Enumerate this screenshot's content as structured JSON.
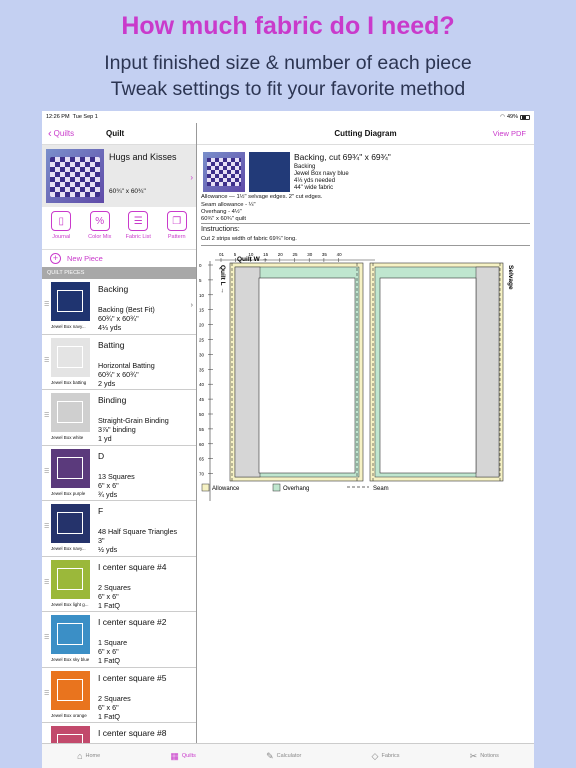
{
  "hero": {
    "title": "How much fabric do I need?",
    "line1": "Input finished size & number of each piece",
    "line2": "Tweak settings to fit your favorite method"
  },
  "status": {
    "time": "12:26 PM",
    "date": "Tue Sep 1",
    "battery": "49%"
  },
  "left_nav": {
    "back": "Quilts",
    "title": "Quilt"
  },
  "quilt": {
    "name": "Hugs and Kisses",
    "size": "60¾\" x 60¾\""
  },
  "tools": [
    {
      "label": "Journal",
      "icon": "journal-icon"
    },
    {
      "label": "Color Mix",
      "icon": "percent-icon"
    },
    {
      "label": "Fabric List",
      "icon": "list-icon"
    },
    {
      "label": "Pattern",
      "icon": "pattern-icon"
    }
  ],
  "new_piece": "New Piece",
  "section_title": "QUILT PIECES",
  "pieces": [
    {
      "title": "Backing",
      "d1": "Backing (Best Fit)",
      "d2": "60¾\" x 60¾\"",
      "d3": "4⅓ yds",
      "fabric": "Jewel Box navy...",
      "color": "#1f3470"
    },
    {
      "title": "Batting",
      "d1": "Horizontal Batting",
      "d2": "60¾\" x 60¾\"",
      "d3": "2 yds",
      "fabric": "Jewel Box batting",
      "color": "#e4e4e4"
    },
    {
      "title": "Binding",
      "d1": "Straight-Grain Binding",
      "d2": "3⅞\" binding",
      "d3": "1 yd",
      "fabric": "Jewel Box white",
      "color": "#cfcfcf"
    },
    {
      "title": "D",
      "d1": "13 Squares",
      "d2": "6\" x 6\"",
      "d3": "¾ yds",
      "fabric": "Jewel Box purple",
      "color": "#5b3a7c"
    },
    {
      "title": "F",
      "d1": "48 Half Square Triangles",
      "d2": "3\"",
      "d3": "½ yds",
      "fabric": "Jewel Box navy...",
      "color": "#25336b"
    },
    {
      "title": "I center square #4",
      "d1": "2 Squares",
      "d2": "6\" x 6\"",
      "d3": "1 FatQ",
      "fabric": "Jewel Box light g...",
      "color": "#9bb83a"
    },
    {
      "title": "I center square #2",
      "d1": "1 Square",
      "d2": "6\" x 6\"",
      "d3": "1 FatQ",
      "fabric": "Jewel Box sky blue",
      "color": "#3b8fc6"
    },
    {
      "title": "I center square #5",
      "d1": "2 Squares",
      "d2": "6\" x 6\"",
      "d3": "1 FatQ",
      "fabric": "Jewel Box orange",
      "color": "#e9741e"
    },
    {
      "title": "I center square #8",
      "d1": "",
      "d2": "",
      "d3": "",
      "fabric": "",
      "color": "#c24a6c"
    }
  ],
  "right_nav": {
    "title": "Cutting Diagram",
    "action": "View PDF"
  },
  "cut": {
    "title": "Backing, cut 69¾\" x 69¾\"",
    "l1": "Backing",
    "l2": "Jewel Box navy blue",
    "l3": "4⅓ yds needed",
    "l4": "44\" wide fabric",
    "a1": "Allowance — 1½\" selvage edges. 2\" cut edges.",
    "a2": "Seam allowance - ¼\"",
    "a3": "Overhang - 4½\"",
    "a4": "60¾\" x 60¾\" quilt",
    "instr_h": "Instructions:",
    "instr": "Cut 2 strips width of fabric 69¾\" long."
  },
  "diagram": {
    "top_ticks": [
      "01",
      "5",
      "10",
      "15",
      "20",
      "25",
      "30",
      "35",
      "40"
    ],
    "left_ticks": [
      "0",
      "5",
      "10",
      "15",
      "20",
      "25",
      "30",
      "35",
      "40",
      "45",
      "50",
      "55",
      "60",
      "65",
      "70"
    ],
    "quilt_w": "Quilt W →",
    "quilt_l": "Quilt L →",
    "selvage": "Selvage",
    "legend": {
      "allowance": "Allowance",
      "overhang": "Overhang",
      "seam": "Seam"
    },
    "colors": {
      "allowance": "#f6f2c4",
      "overhang": "#bfe6cf",
      "edge": "#d6d6d6"
    }
  },
  "tabs": [
    {
      "label": "Home",
      "icon": "home-icon",
      "active": false
    },
    {
      "label": "Quilts",
      "icon": "quilts-icon",
      "active": true
    },
    {
      "label": "Calculator",
      "icon": "calculator-icon",
      "active": false
    },
    {
      "label": "Fabrics",
      "icon": "fabrics-icon",
      "active": false
    },
    {
      "label": "Notions",
      "icon": "notions-icon",
      "active": false
    }
  ]
}
